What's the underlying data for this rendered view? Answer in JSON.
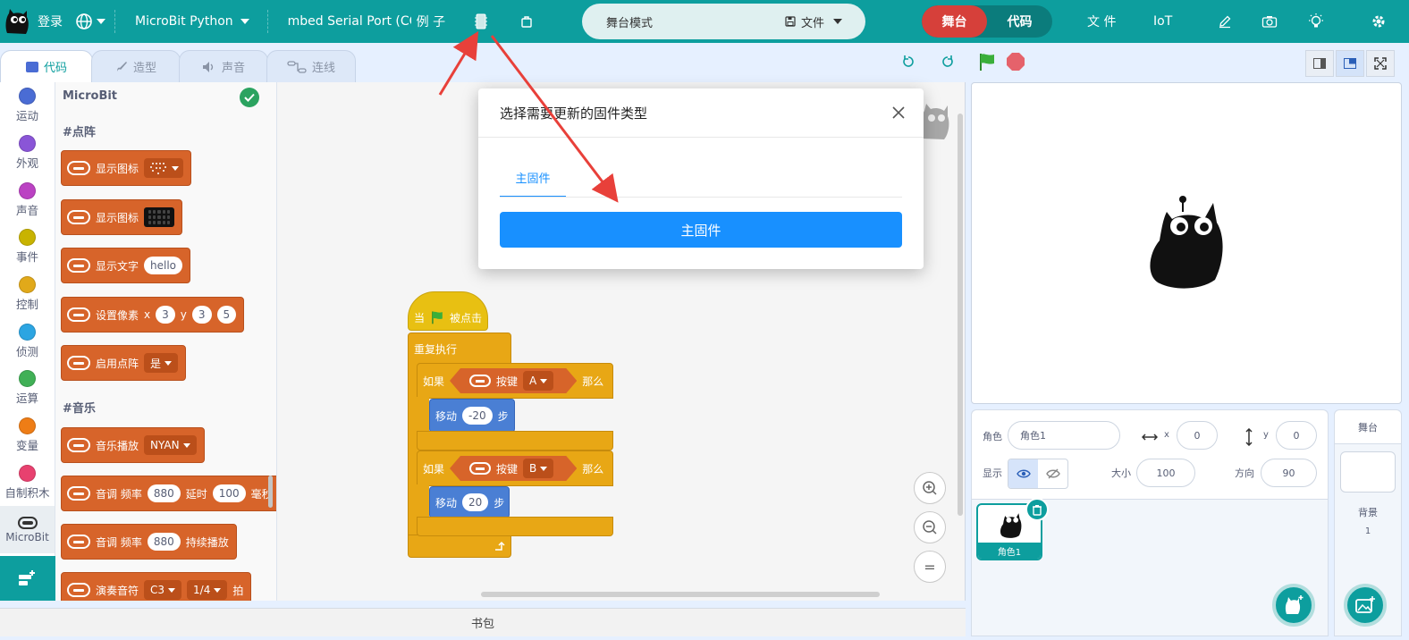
{
  "menubar": {
    "login": "登录",
    "language_icon": "globe-icon",
    "language_caret": "caret-down",
    "device": "MicroBit Python",
    "serial_port": "mbed Serial Port (COM",
    "examples": "例 子",
    "stage_mode": "舞台模式",
    "file_menu": "文件",
    "mode_stage": "舞台",
    "mode_code": "代码",
    "file": "文 件",
    "iot": "IoT"
  },
  "tabs": {
    "code": "代码",
    "costume": "造型",
    "sound": "声音",
    "wire": "连线"
  },
  "categories": [
    {
      "label": "运动",
      "color": "#4a6cd4"
    },
    {
      "label": "外观",
      "color": "#8a55d7"
    },
    {
      "label": "声音",
      "color": "#bb42c3"
    },
    {
      "label": "事件",
      "color": "#c8b300"
    },
    {
      "label": "控制",
      "color": "#e1a91a"
    },
    {
      "label": "侦测",
      "color": "#2ca5e2"
    },
    {
      "label": "运算",
      "color": "#40b056"
    },
    {
      "label": "变量",
      "color": "#ee7d16"
    },
    {
      "label": "自制积木",
      "color": "#e8416f"
    },
    {
      "label": "MicroBit",
      "color": "#333333"
    }
  ],
  "palette": {
    "header": "MicroBit",
    "section_matrix": "#点阵",
    "section_music": "#音乐",
    "blocks": {
      "show_icon_1": "显示图标",
      "show_icon_2": "显示图标",
      "show_text": "显示文字",
      "show_text_value": "hello",
      "set_pixel": "设置像素",
      "set_pixel_x_label": "x",
      "set_pixel_x": "3",
      "set_pixel_y_label": "y",
      "set_pixel_y": "3",
      "set_pixel_val": "5",
      "enable_matrix": "启用点阵",
      "enable_matrix_value": "是",
      "music_play": "音乐播放",
      "music_value": "NYAN",
      "tone_label": "音调 频率",
      "tone_freq": "880",
      "tone_delay_label": "延时",
      "tone_delay": "100",
      "tone_extra": "毫秒",
      "tone2_label": "音调 频率",
      "tone2_freq": "880",
      "tone2_suffix": "持续播放",
      "note_label": "演奏音符",
      "note_value": "C3",
      "note_beat": "1/4",
      "note_suffix": "拍"
    }
  },
  "script": {
    "hat": "当",
    "hat_suffix": "被点击",
    "forever": "重复执行",
    "if1": "如果",
    "button_label1": "按键",
    "button_a": "A",
    "then1": "那么",
    "move1": "移动",
    "move1_val": "-20",
    "step1": "步",
    "if2": "如果",
    "button_label2": "按键",
    "button_b": "B",
    "then2": "那么",
    "move2": "移动",
    "move2_val": "20",
    "step2": "步"
  },
  "workspace": {
    "zoom_in": "+",
    "zoom_out": "−",
    "zoom_reset": "="
  },
  "bottombar": {
    "backpack": "书包"
  },
  "sprite": {
    "label": "角色",
    "name": "角色1",
    "x_label": "x",
    "x": "0",
    "y_label": "y",
    "y": "0",
    "show_label": "显示",
    "size_label": "大小",
    "size": "100",
    "direction_label": "方向",
    "direction": "90",
    "thumb_name": "角色1"
  },
  "backdrop": {
    "stage_label": "舞台",
    "backdrop_label": "背景",
    "count": "1"
  },
  "dialog": {
    "title": "选择需要更新的固件类型",
    "tab": "主固件",
    "button": "主固件"
  },
  "colors": {
    "teal": "#0d9e9e",
    "accent_red": "#d6403a",
    "primary_blue": "#1890ff",
    "arrow_red": "#e8403a"
  }
}
